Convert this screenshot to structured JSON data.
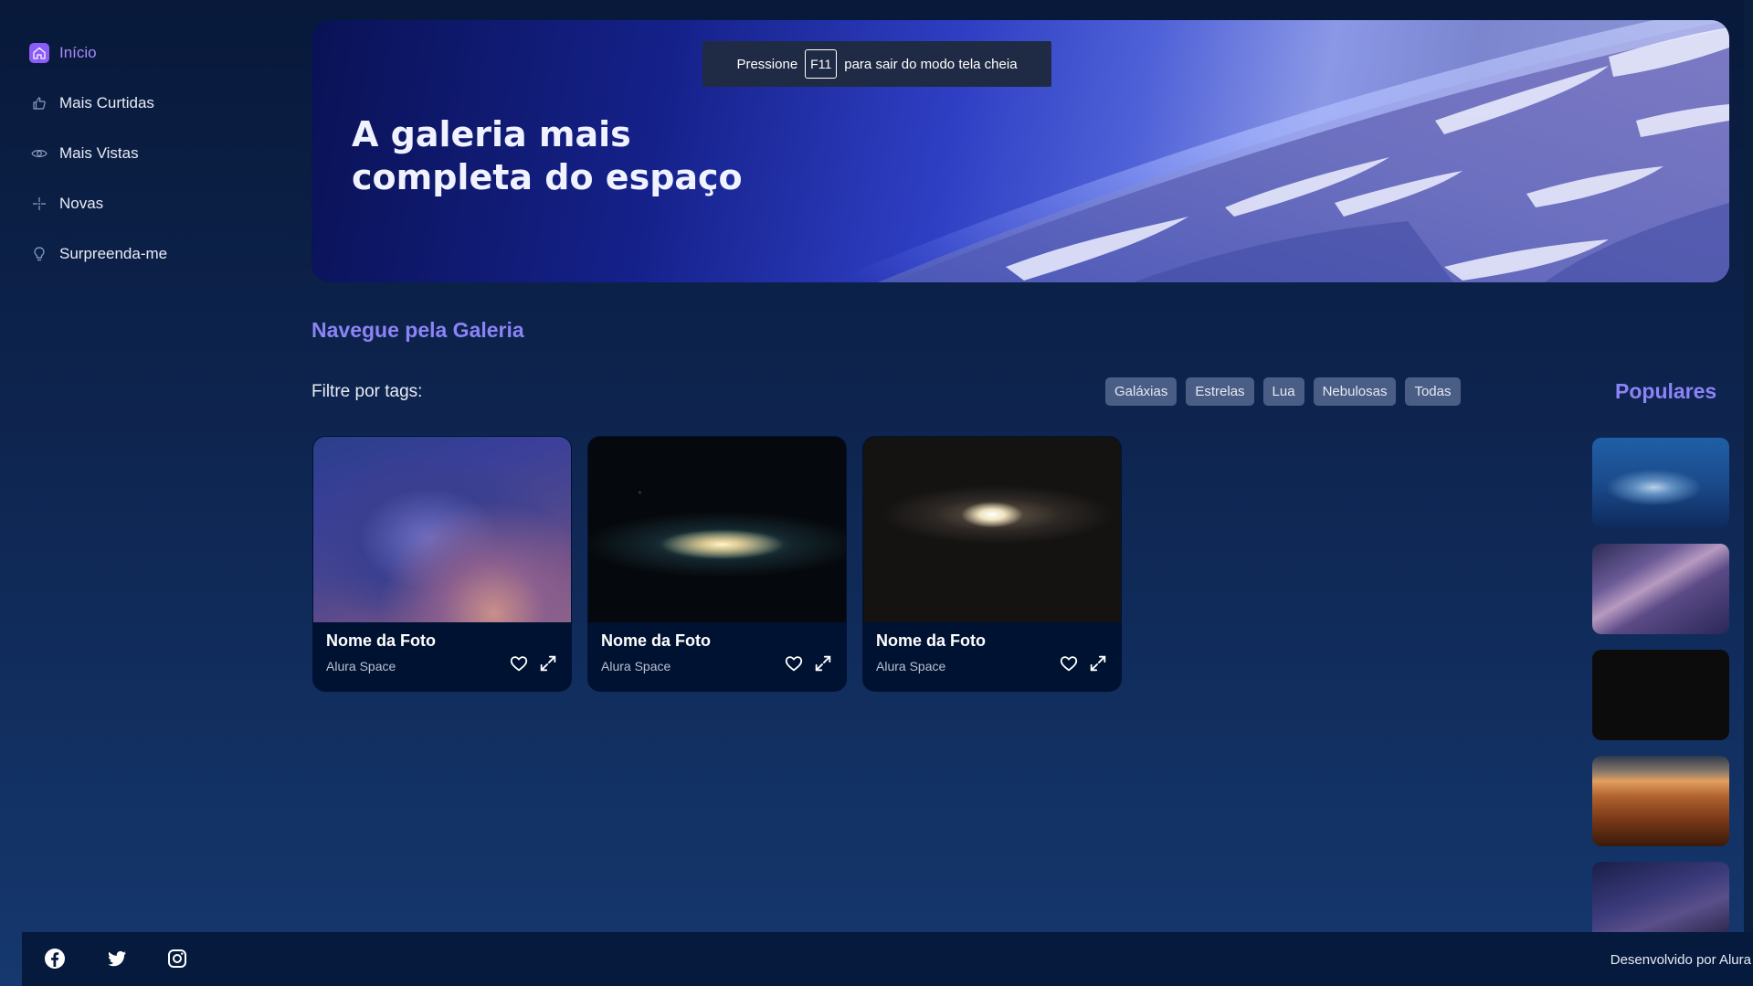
{
  "sidebar": {
    "items": [
      {
        "label": "Início",
        "icon": "home-icon",
        "active": true
      },
      {
        "label": "Mais Curtidas",
        "icon": "thumbs-up-icon",
        "active": false
      },
      {
        "label": "Mais Vistas",
        "icon": "eye-icon",
        "active": false
      },
      {
        "label": "Novas",
        "icon": "sparkle-icon",
        "active": false
      },
      {
        "label": "Surpreenda-me",
        "icon": "lightbulb-icon",
        "active": false
      }
    ]
  },
  "banner": {
    "title": "A galeria mais\ncompleta do espaço"
  },
  "fullscreen_notice": {
    "prefix": "Pressione",
    "key": "F11",
    "suffix": "para sair do modo tela cheia"
  },
  "gallery": {
    "title": "Navegue pela Galeria",
    "filter_label": "Filtre por tags:",
    "tags": [
      "Galáxias",
      "Estrelas",
      "Lua",
      "Nebulosas",
      "Todas"
    ],
    "cards": [
      {
        "name": "Nome da Foto",
        "author": "Alura Space"
      },
      {
        "name": "Nome da Foto",
        "author": "Alura Space"
      },
      {
        "name": "Nome da Foto",
        "author": "Alura Space"
      }
    ]
  },
  "popular": {
    "title": "Populares"
  },
  "footer": {
    "text": "Desenvolvido por Alura",
    "social": [
      "facebook-icon",
      "twitter-icon",
      "instagram-icon"
    ]
  },
  "colors": {
    "accent": "#8b83f6",
    "active": "#a78bfa",
    "tag_bg": "#4a5d84",
    "card_bg": "#001232",
    "footer_bg": "#051a3d"
  }
}
